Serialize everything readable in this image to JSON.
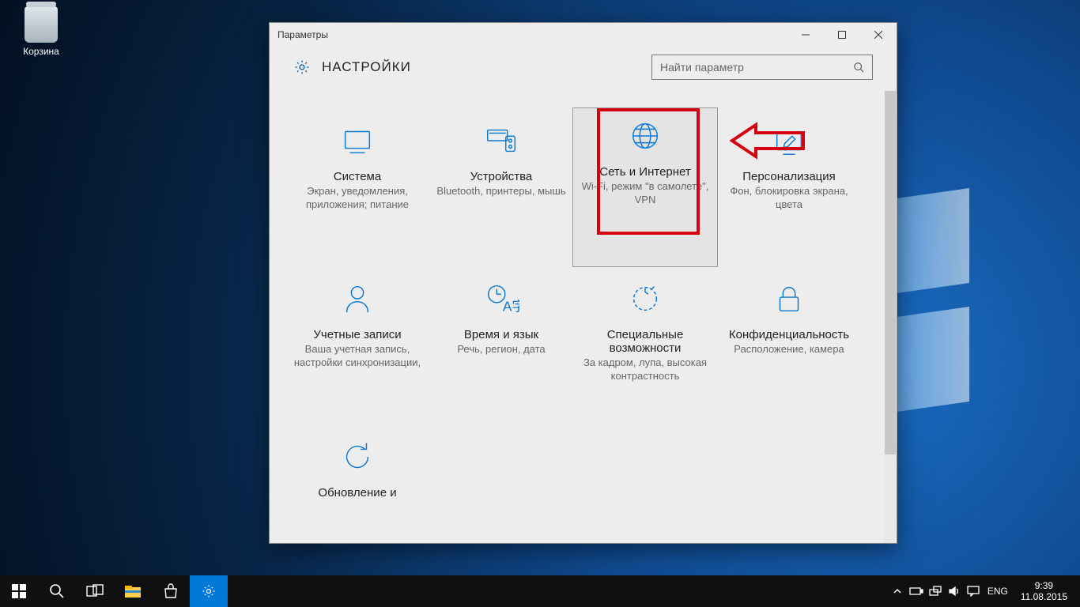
{
  "desktop": {
    "recycle_label": "Корзина"
  },
  "window": {
    "title": "Параметры",
    "heading": "НАСТРОЙКИ",
    "search_placeholder": "Найти параметр"
  },
  "categories": [
    {
      "title": "Система",
      "sub": "Экран, уведомления, приложения; питание"
    },
    {
      "title": "Устройства",
      "sub": "Bluetooth, принтеры, мышь"
    },
    {
      "title": "Сеть и Интернет",
      "sub": "Wi-Fi, режим \"в самолете\", VPN"
    },
    {
      "title": "Персонализация",
      "sub": "Фон, блокировка экрана, цвета"
    },
    {
      "title": "Учетные записи",
      "sub": "Ваша учетная запись, настройки синхронизации,"
    },
    {
      "title": "Время и язык",
      "sub": "Речь, регион, дата"
    },
    {
      "title": "Специальные возможности",
      "sub": "За кадром, лупа, высокая контрастность"
    },
    {
      "title": "Конфиденциальность",
      "sub": "Расположение, камера"
    },
    {
      "title": "Обновление и",
      "sub": ""
    }
  ],
  "tray": {
    "lang": "ENG",
    "time": "9:39",
    "date": "11.08.2015"
  }
}
